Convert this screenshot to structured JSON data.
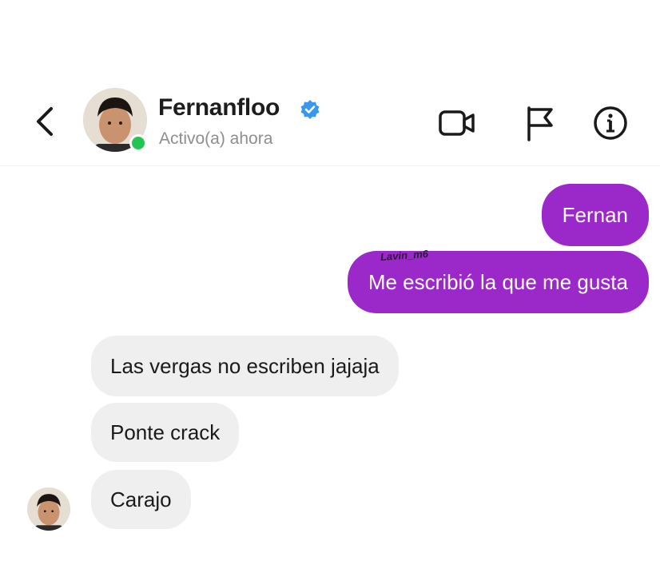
{
  "header": {
    "contact_name": "Fernanfloo",
    "status": "Activo(a) ahora",
    "icons": [
      "back-chevron-icon",
      "verified-badge-icon",
      "video-call-icon",
      "report-flag-icon",
      "info-icon"
    ],
    "online": true
  },
  "messages": [
    {
      "from": "me",
      "text": "Fernan"
    },
    {
      "from": "me",
      "text": "Me escribió la que me gusta"
    },
    {
      "from": "contact",
      "text": "Las vergas no escriben jajaja"
    },
    {
      "from": "contact",
      "text": "Ponte crack"
    },
    {
      "from": "contact",
      "text": "Carajo"
    }
  ],
  "watermark": "Lavin_m6",
  "colors": {
    "outgoing_bubble": "#9b28c9",
    "incoming_bubble": "#efefef",
    "online_dot": "#23c552",
    "verified_badge": "#3897f0"
  }
}
